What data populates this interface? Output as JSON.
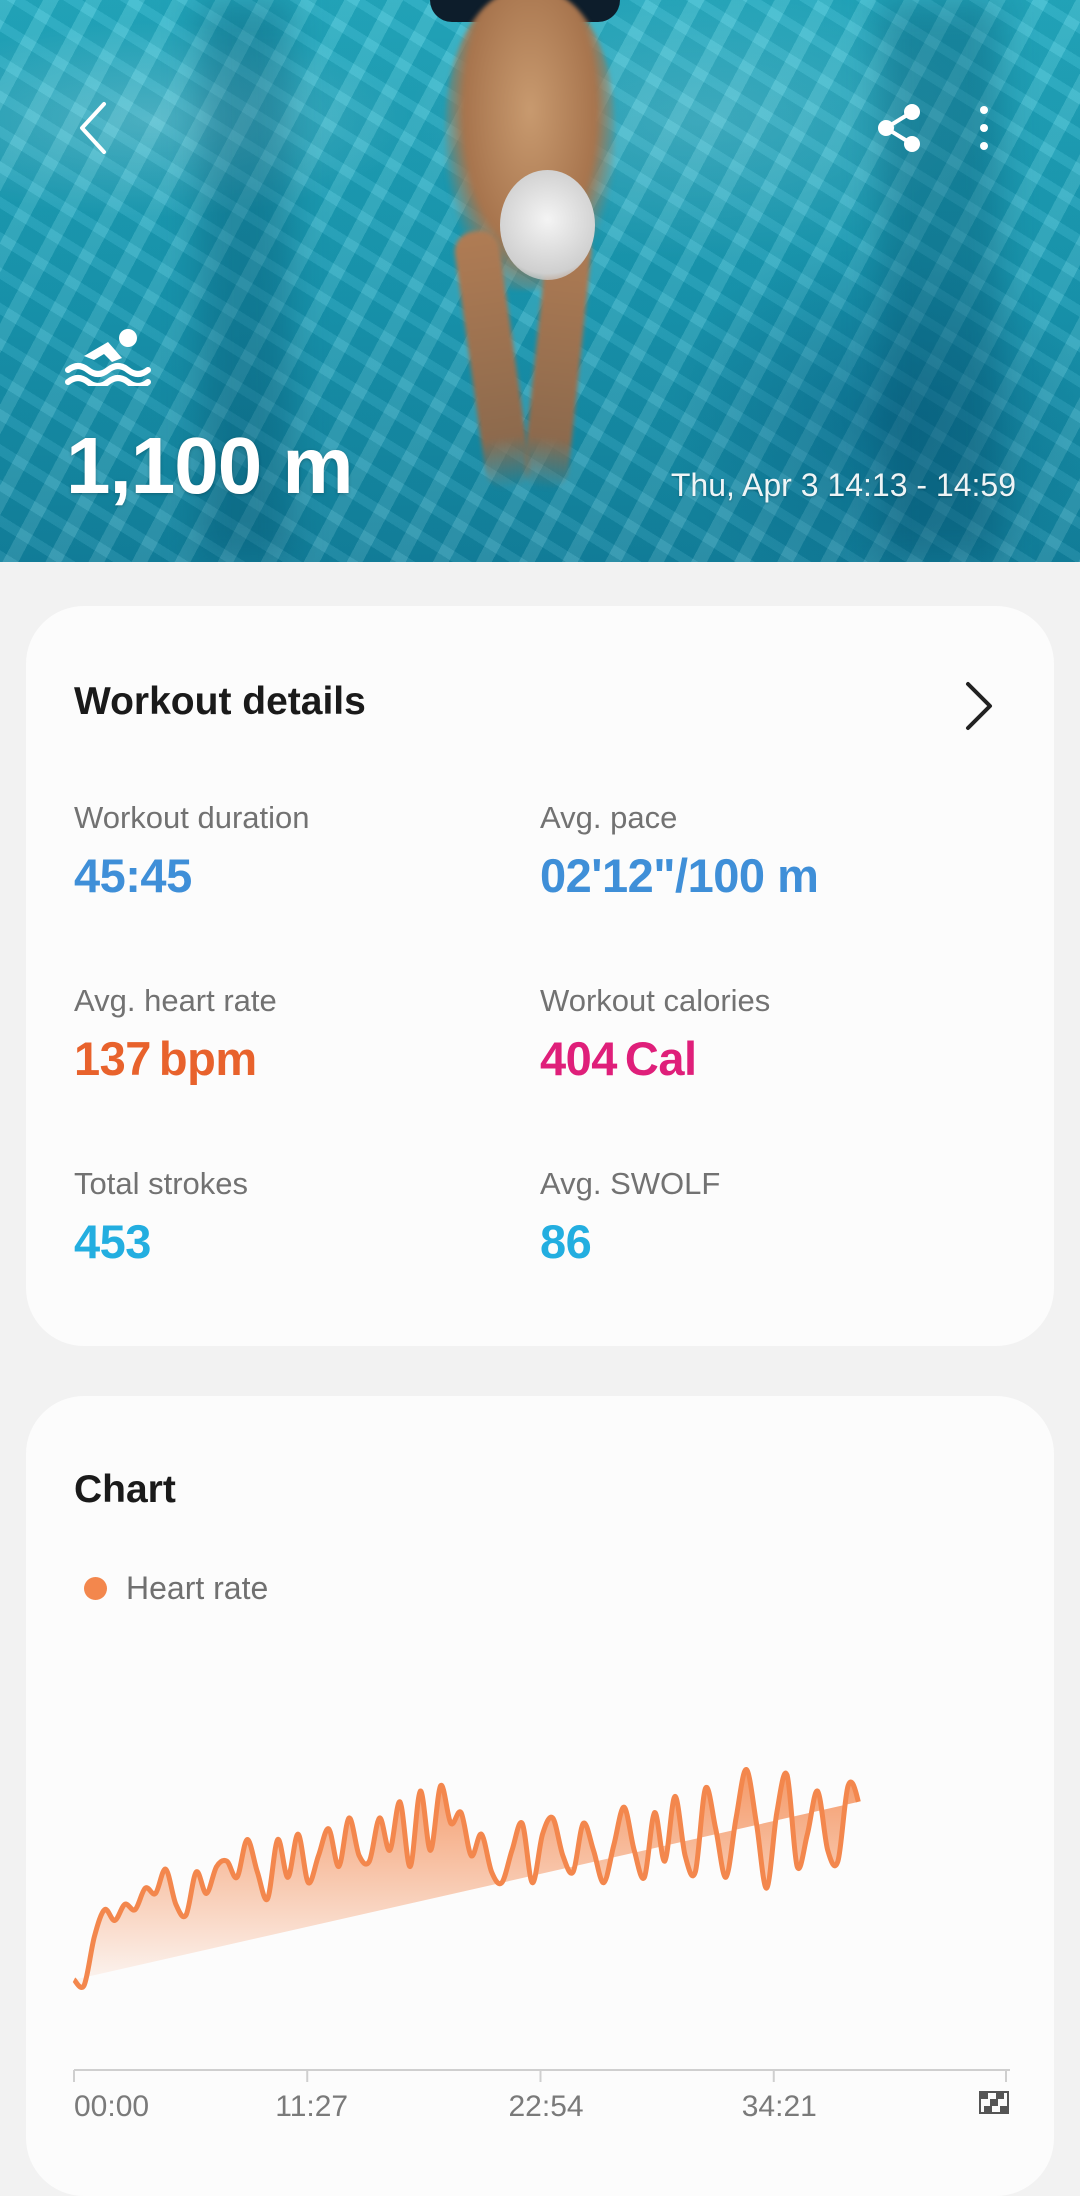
{
  "header": {
    "distance": "1,100 m",
    "date_range": "Thu, Apr 3 14:13 - 14:59",
    "icons": [
      "back-arrow-icon",
      "share-icon",
      "more-vertical-icon",
      "swimming-icon"
    ]
  },
  "workout_details": {
    "title": "Workout details",
    "stats": [
      {
        "label": "Workout duration",
        "value": "45:45",
        "unit": "",
        "color": "#3f8fd8"
      },
      {
        "label": "Avg. pace",
        "value": "02'12\"",
        "unit": "/100 m",
        "color": "#3f8fd8"
      },
      {
        "label": "Avg. heart rate",
        "value": "137",
        "unit": "bpm",
        "color": "#e8622c"
      },
      {
        "label": "Workout calories",
        "value": "404",
        "unit": "Cal",
        "color": "#df1f7a"
      },
      {
        "label": "Total strokes",
        "value": "453",
        "unit": "",
        "color": "#23aee0"
      },
      {
        "label": "Avg. SWOLF",
        "value": "86",
        "unit": "",
        "color": "#23aee0"
      }
    ]
  },
  "chart_section": {
    "title": "Chart",
    "legend_label": "Heart rate",
    "legend_color": "#f3874d"
  },
  "chart_data": {
    "type": "area",
    "series": [
      {
        "name": "Heart rate",
        "color": "#f3874d"
      }
    ],
    "x_tick_labels": [
      "00:00",
      "11:27",
      "22:54",
      "34:21"
    ],
    "x_minutes": [
      0,
      0.5,
      1,
      1.5,
      2,
      2.5,
      3,
      3.5,
      4,
      4.5,
      5,
      5.5,
      6,
      6.5,
      7,
      7.5,
      8,
      8.5,
      9,
      9.5,
      10,
      10.5,
      11,
      11.5,
      12,
      12.5,
      13,
      13.5,
      14,
      14.5,
      15,
      15.5,
      16,
      16.5,
      17,
      17.5,
      18,
      18.5,
      19,
      19.5,
      20,
      20.5,
      21,
      21.5,
      22,
      22.5,
      23,
      23.5,
      24,
      24.5,
      25,
      25.5,
      26,
      26.5,
      27,
      27.5,
      28,
      28.5,
      29,
      29.5,
      30,
      30.5,
      31,
      31.5,
      32,
      32.5,
      33,
      33.5,
      34,
      34.5,
      35,
      35.5,
      36,
      36.5,
      37,
      37.5,
      38,
      38.5,
      39,
      39.5,
      40,
      40.5,
      41,
      41.5,
      42,
      42.5,
      43,
      43.5,
      44,
      44.5,
      45,
      45.5
    ],
    "y_bpm": [
      92,
      90,
      108,
      118,
      114,
      120,
      118,
      126,
      124,
      133,
      120,
      116,
      132,
      124,
      134,
      136,
      130,
      144,
      132,
      122,
      144,
      130,
      146,
      128,
      138,
      148,
      134,
      152,
      138,
      136,
      152,
      140,
      158,
      134,
      162,
      140,
      164,
      150,
      154,
      138,
      146,
      132,
      128,
      140,
      150,
      128,
      146,
      152,
      138,
      132,
      150,
      140,
      128,
      142,
      156,
      140,
      130,
      154,
      136,
      160,
      138,
      132,
      163,
      148,
      130,
      152,
      170,
      150,
      126,
      154,
      168,
      134,
      146,
      162,
      140,
      136,
      164,
      158,
      132
    ]
  }
}
